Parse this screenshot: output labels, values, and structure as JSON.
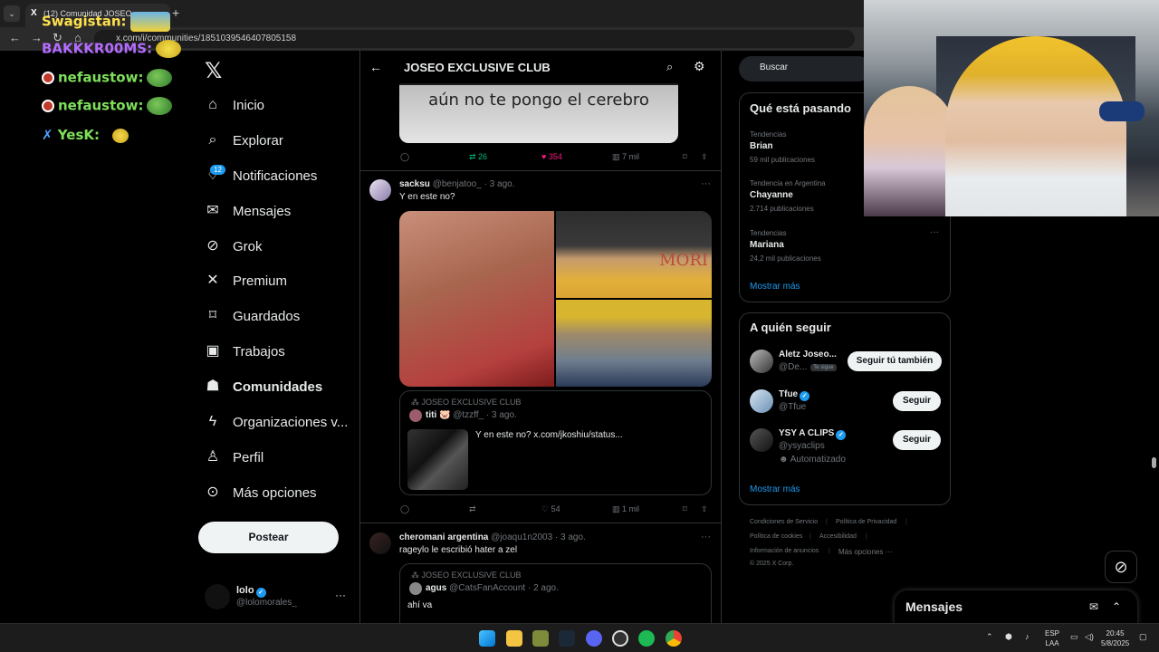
{
  "browser": {
    "tab_title": "(12) Comunidad JOSEO",
    "url": "x.com/i/communities/1851039546407805158"
  },
  "chat": [
    {
      "user": "Swagistan:",
      "color": "#ffe14d"
    },
    {
      "user": "BAKKKR00MS:",
      "color": "#b46cff"
    },
    {
      "user": "nefaustow:",
      "color": "#7ee05a"
    },
    {
      "user": "nefaustow:",
      "color": "#7ee05a"
    },
    {
      "user": "YesK:",
      "color": "#7ee05a"
    }
  ],
  "nav": {
    "items": [
      {
        "label": "Inicio",
        "icon": "home-icon"
      },
      {
        "label": "Explorar",
        "icon": "search-icon"
      },
      {
        "label": "Notificaciones",
        "icon": "bell-icon"
      },
      {
        "label": "Mensajes",
        "icon": "mail-icon"
      },
      {
        "label": "Grok",
        "icon": "grok-icon"
      },
      {
        "label": "Premium",
        "icon": "x-icon"
      },
      {
        "label": "Guardados",
        "icon": "bookmark-icon"
      },
      {
        "label": "Trabajos",
        "icon": "briefcase-icon"
      },
      {
        "label": "Comunidades",
        "icon": "people-icon"
      },
      {
        "label": "Organizaciones v...",
        "icon": "lightning-icon"
      },
      {
        "label": "Perfil",
        "icon": "person-icon"
      },
      {
        "label": "Más opciones",
        "icon": "more-circle-icon"
      }
    ],
    "notification_count": "12",
    "post_button": "Postear",
    "account": {
      "name": "lolo",
      "handle": "@lolomorales_"
    }
  },
  "timeline": {
    "title": "JOSEO EXCLUSIVE CLUB",
    "meme_text": "aún no te pongo el cerebro",
    "post0_actions": {
      "retweets": "26",
      "likes": "354",
      "views": "7 mil"
    },
    "post1": {
      "name": "sacksu",
      "handle": "@benjatoo_",
      "time": "· 3 ago.",
      "text": "Y en este no?",
      "image_text": "MORI",
      "quote": {
        "community": "JOSEO EXCLUSIVE CLUB",
        "name": "titi 🐷",
        "handle": "@tzzff_",
        "time": "· 3 ago.",
        "text": "Y en este no?  x.com/jkoshiu/status..."
      },
      "actions": {
        "likes": "54",
        "views": "1 mil"
      }
    },
    "post2": {
      "name": "cheromani argentina",
      "handle": "@joaqu1n2003",
      "time": "· 3 ago.",
      "text": "rageylo le escribió hater a zel",
      "quote": {
        "community": "JOSEO EXCLUSIVE CLUB",
        "name": "agus",
        "handle": "@CatsFanAccount",
        "time": "· 2 ago.",
        "text": "ahí va"
      }
    }
  },
  "sidebar": {
    "search_placeholder": "Buscar",
    "trends_title": "Qué está pasando",
    "trends": [
      {
        "category": "Tendencias",
        "name": "Brian",
        "count": "59 mil publicaciones"
      },
      {
        "category": "Tendencia en Argentina",
        "name": "Chayanne",
        "count": "2.714 publicaciones"
      },
      {
        "category": "Tendencias",
        "name": "Mariana",
        "count": "24,2 mil publicaciones"
      }
    ],
    "show_more": "Mostrar más",
    "follow_title": "A quién seguir",
    "follow": [
      {
        "name": "Aletz Joseo...",
        "handle": "@De...",
        "badge": "Te sigue",
        "button": "Seguir tú también"
      },
      {
        "name": "Tfue",
        "handle": "@Tfue",
        "button": "Seguir"
      },
      {
        "name": "YSY A CLIPS",
        "handle": "@ysyaclips",
        "sub": "Automatizado",
        "button": "Seguir"
      }
    ],
    "footer": [
      "Condiciones de Servicio",
      "Política de Privacidad",
      "Política de cookies",
      "Accesibilidad",
      "Información de anuncios",
      "Más opciones ···",
      "© 2025 X Corp."
    ]
  },
  "messages": {
    "title": "Mensajes"
  },
  "taskbar": {
    "lang": "ESP",
    "lang2": "LAA",
    "time": "20:45",
    "date": "5/8/2025"
  }
}
